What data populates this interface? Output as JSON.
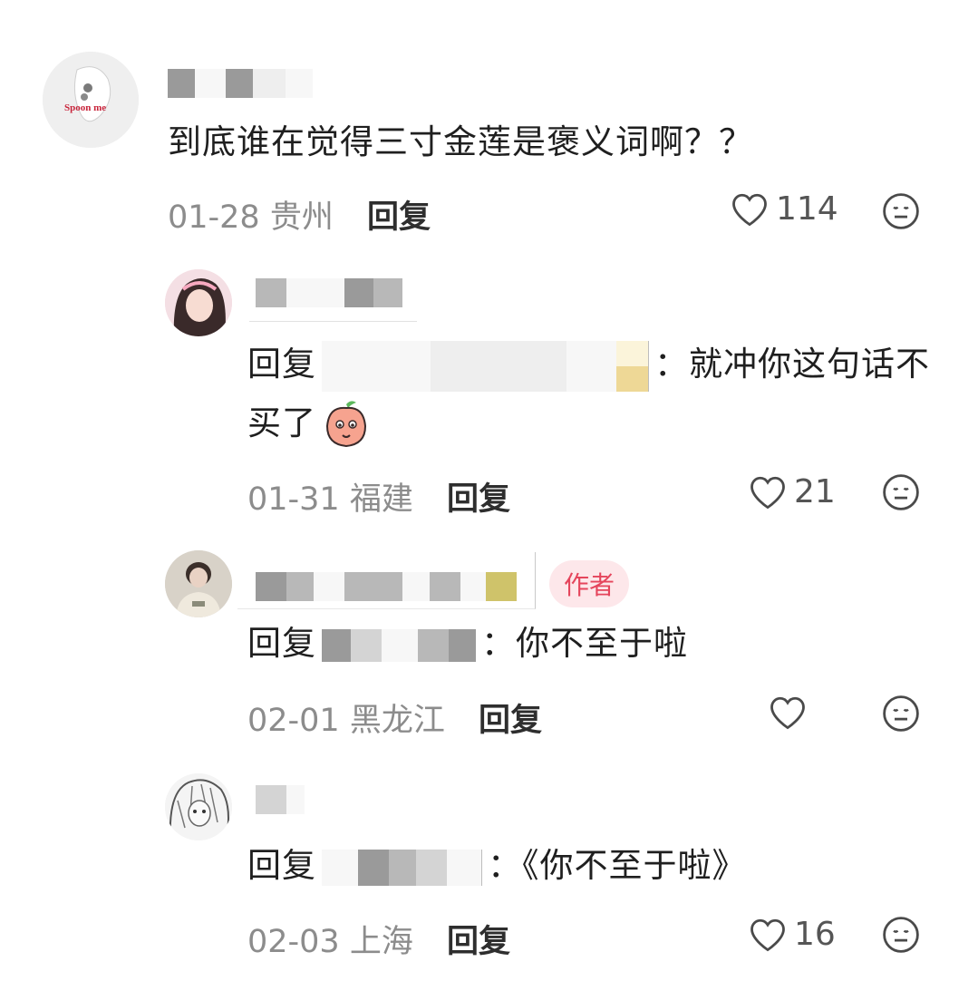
{
  "comments": [
    {
      "text": "到底谁在觉得三寸金莲是褒义词啊？？",
      "avatar_text": "Spoon me",
      "date": "01-28",
      "location": "贵州",
      "reply_label": "回复",
      "likes": "114"
    },
    {
      "reply_prefix": "回复",
      "text_line1": "：就冲你这句话不",
      "text_line2": "买了",
      "date": "01-31",
      "location": "福建",
      "reply_label": "回复",
      "likes": "21"
    },
    {
      "badge": "作者",
      "reply_prefix": "回复",
      "text": "：你不至于啦",
      "date": "02-01",
      "location": "黑龙江",
      "reply_label": "回复",
      "likes": ""
    },
    {
      "reply_prefix": "回复",
      "text": "：《你不至于啦》",
      "date": "02-03",
      "location": "上海",
      "reply_label": "回复",
      "likes": "16"
    }
  ]
}
